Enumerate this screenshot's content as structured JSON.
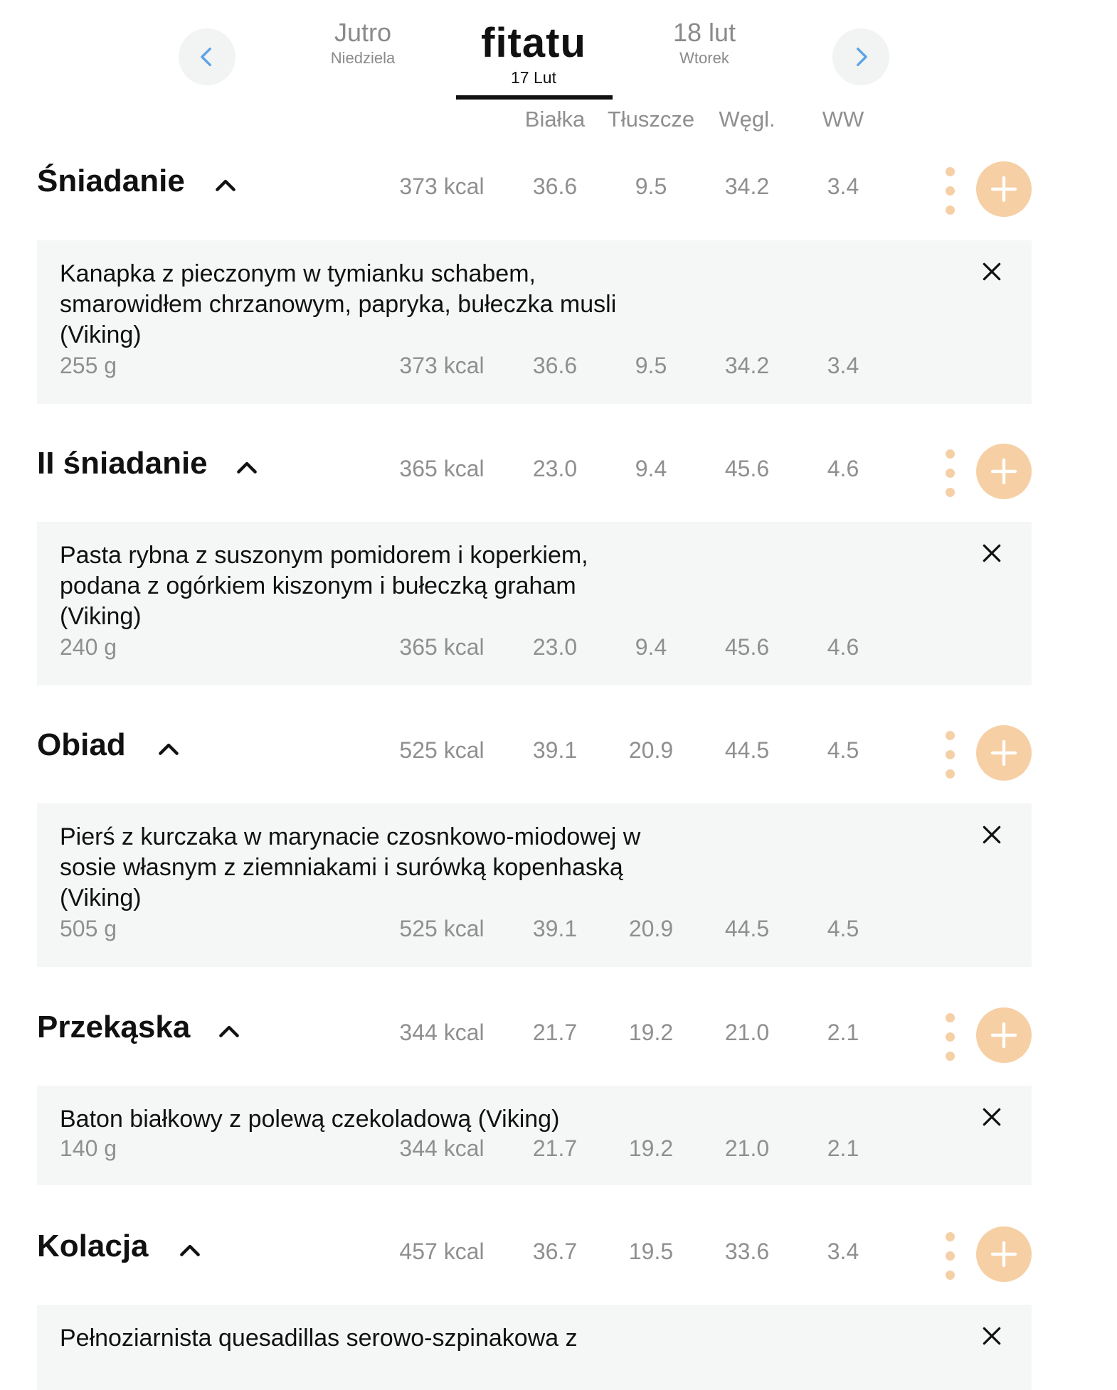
{
  "header": {
    "prev_day": {
      "label": "Jutro",
      "weekday": "Niedziela"
    },
    "logo": "fitatu",
    "current_date": "17 Lut",
    "next_day": {
      "label": "18 lut",
      "weekday": "Wtorek"
    }
  },
  "columns": [
    "Białka",
    "Tłuszcze",
    "Węgl.",
    "WW"
  ],
  "meals": [
    {
      "name": "Śniadanie",
      "kcal": "373 kcal",
      "protein": "36.6",
      "fat": "9.5",
      "carbs": "34.2",
      "ww": "3.4",
      "item": {
        "name": "Kanapka z pieczonym w tymianku schabem, smarowidłem chrzanowym, papryka, bułeczka musli (Viking)",
        "weight": "255 g",
        "kcal": "373 kcal",
        "protein": "36.6",
        "fat": "9.5",
        "carbs": "34.2",
        "ww": "3.4"
      }
    },
    {
      "name": "II śniadanie",
      "kcal": "365 kcal",
      "protein": "23.0",
      "fat": "9.4",
      "carbs": "45.6",
      "ww": "4.6",
      "item": {
        "name": "Pasta rybna z suszonym pomidorem i koperkiem, podana z ogórkiem kiszonym i bułeczką graham (Viking)",
        "weight": "240 g",
        "kcal": "365 kcal",
        "protein": "23.0",
        "fat": "9.4",
        "carbs": "45.6",
        "ww": "4.6"
      }
    },
    {
      "name": "Obiad",
      "kcal": "525 kcal",
      "protein": "39.1",
      "fat": "20.9",
      "carbs": "44.5",
      "ww": "4.5",
      "item": {
        "name": "Pierś z kurczaka w marynacie czosnkowo-miodowej w sosie własnym z ziemniakami i surówką kopenhaską (Viking)",
        "weight": "505 g",
        "kcal": "525 kcal",
        "protein": "39.1",
        "fat": "20.9",
        "carbs": "44.5",
        "ww": "4.5"
      }
    },
    {
      "name": "Przekąska",
      "kcal": "344 kcal",
      "protein": "21.7",
      "fat": "19.2",
      "carbs": "21.0",
      "ww": "2.1",
      "item": {
        "name": "Baton białkowy z polewą czekoladową (Viking)",
        "weight": "140 g",
        "kcal": "344 kcal",
        "protein": "21.7",
        "fat": "19.2",
        "carbs": "21.0",
        "ww": "2.1"
      }
    },
    {
      "name": "Kolacja",
      "kcal": "457 kcal",
      "protein": "36.7",
      "fat": "19.5",
      "carbs": "33.6",
      "ww": "3.4",
      "item": {
        "name": "Pełnoziarnista quesadillas serowo-szpinakowa z"
      }
    }
  ],
  "colors": {
    "accent": "#f6cfa4",
    "card_bg": "#f5f6f6",
    "muted": "#8f8f8f",
    "nav_arrow": "#5ba3e6"
  }
}
